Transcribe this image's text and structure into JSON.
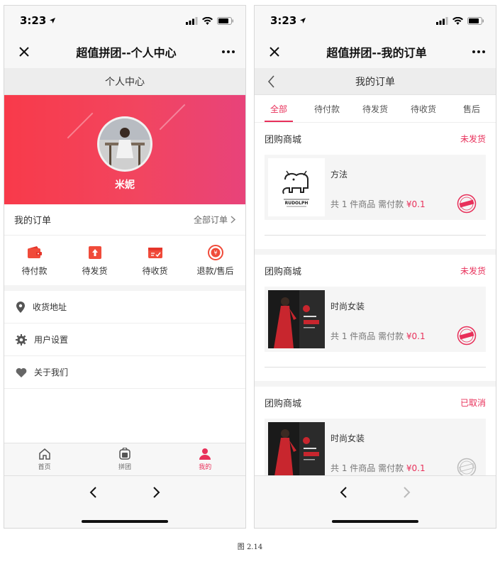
{
  "left": {
    "status_time": "3:23",
    "window_title": "超值拼团--个人中心",
    "page_title": "个人中心",
    "profile": {
      "username": "米妮"
    },
    "orders": {
      "title": "我的订单",
      "all_link": "全部订单",
      "statuses": [
        {
          "label": "待付款",
          "icon": "wallet-icon"
        },
        {
          "label": "待发货",
          "icon": "box-upload-icon"
        },
        {
          "label": "待收货",
          "icon": "delivery-icon"
        },
        {
          "label": "退款/售后",
          "icon": "refund-icon"
        }
      ]
    },
    "menu": [
      {
        "label": "收货地址",
        "icon": "location-pin-icon"
      },
      {
        "label": "用户设置",
        "icon": "gear-icon"
      },
      {
        "label": "关于我们",
        "icon": "heart-icon"
      }
    ],
    "tabs": [
      {
        "label": "首页",
        "icon": "home-icon",
        "active": false
      },
      {
        "label": "拼团",
        "icon": "group-buy-icon",
        "active": false
      },
      {
        "label": "我的",
        "icon": "user-icon",
        "active": true
      }
    ]
  },
  "right": {
    "status_time": "3:23",
    "window_title": "超值拼团--我的订单",
    "page_title": "我的订单",
    "tabs": [
      "全部",
      "待付款",
      "待发货",
      "待收货",
      "售后"
    ],
    "active_tab": "全部",
    "orders": [
      {
        "shop": "团购商城",
        "state": "未发货",
        "product": "方法",
        "summary_prefix": "共 1 件商品 需付款 ",
        "price": "¥0.1",
        "thumb": "rudolph-logo",
        "thumb_text": "RUDOLPH",
        "stamp": "paid-stamp-icon"
      },
      {
        "shop": "团购商城",
        "state": "未发货",
        "product": "时尚女装",
        "summary_prefix": "共 1 件商品 需付款 ",
        "price": "¥0.1",
        "thumb": "fashion-photo",
        "stamp": "paid-stamp-icon"
      },
      {
        "shop": "团购商城",
        "state": "已取消",
        "product": "时尚女装",
        "summary_prefix": "共 1 件商品 需付款 ",
        "price": "¥0.1",
        "thumb": "fashion-photo",
        "stamp": "cancelled-stamp-icon"
      }
    ]
  },
  "caption": "图 2.14",
  "colors": {
    "accent": "#e8305a",
    "banner_start": "#f83a4a",
    "banner_end": "#e8437a"
  }
}
